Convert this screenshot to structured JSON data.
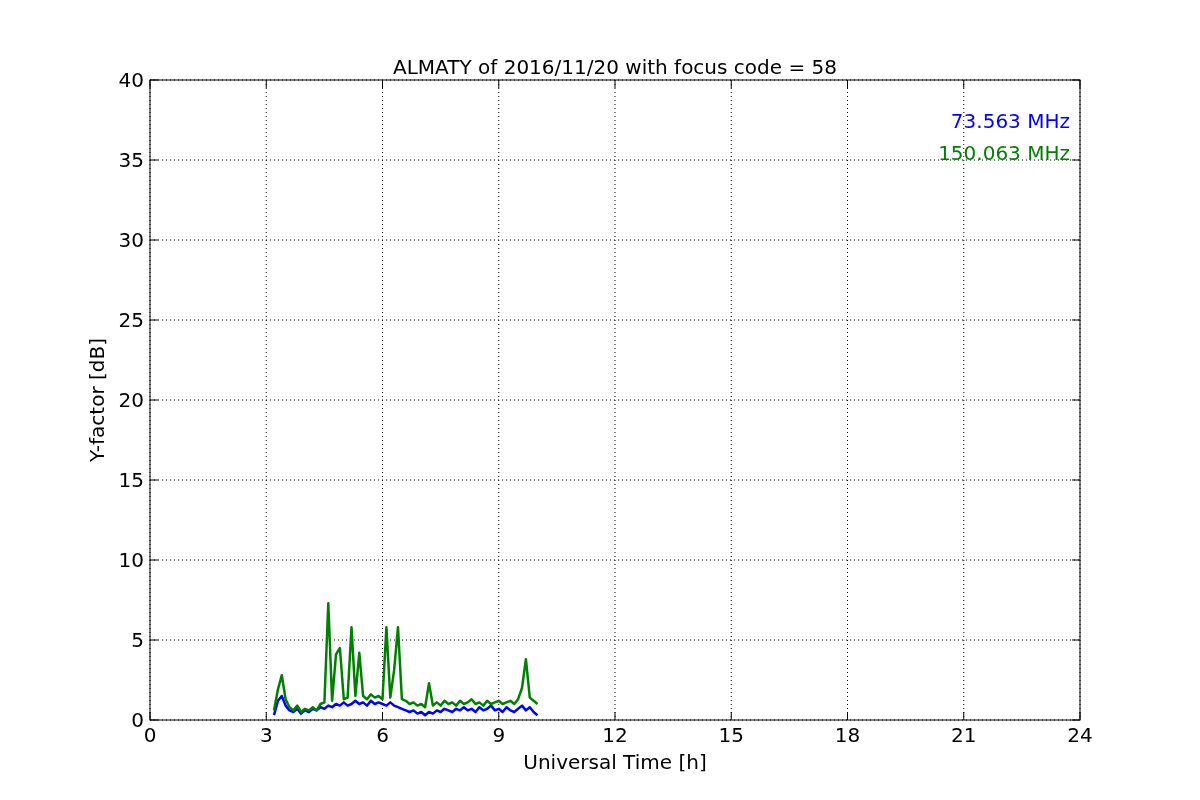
{
  "chart_data": {
    "type": "line",
    "title": "ALMATY of 2016/11/20 with focus code = 58",
    "xlabel": "Universal Time [h]",
    "ylabel": "Y-factor [dB]",
    "x": [
      3.2,
      3.3,
      3.4,
      3.5,
      3.6,
      3.7,
      3.8,
      3.9,
      4.0,
      4.1,
      4.2,
      4.3,
      4.4,
      4.5,
      4.6,
      4.7,
      4.8,
      4.9,
      5.0,
      5.1,
      5.2,
      5.3,
      5.4,
      5.5,
      5.6,
      5.7,
      5.8,
      5.9,
      6.0,
      6.1,
      6.2,
      6.3,
      6.4,
      6.5,
      6.6,
      6.7,
      6.8,
      6.9,
      7.0,
      7.1,
      7.2,
      7.3,
      7.4,
      7.5,
      7.6,
      7.7,
      7.8,
      7.9,
      8.0,
      8.1,
      8.2,
      8.3,
      8.4,
      8.5,
      8.6,
      8.7,
      8.8,
      8.9,
      9.0,
      9.1,
      9.2,
      9.3,
      9.4,
      9.5,
      9.6,
      9.7,
      9.8,
      9.9,
      10.0
    ],
    "series": [
      {
        "name": "73.563 MHz",
        "color": "#0000ff",
        "values": [
          0.3,
          1.2,
          1.5,
          0.9,
          0.6,
          0.5,
          0.7,
          0.4,
          0.6,
          0.5,
          0.7,
          0.6,
          0.8,
          0.7,
          0.9,
          0.8,
          1.0,
          0.9,
          1.1,
          0.9,
          1.0,
          1.2,
          1.0,
          1.1,
          0.9,
          1.2,
          1.0,
          1.1,
          1.0,
          0.9,
          1.1,
          0.9,
          0.8,
          0.7,
          0.6,
          0.5,
          0.6,
          0.4,
          0.5,
          0.3,
          0.5,
          0.4,
          0.6,
          0.5,
          0.7,
          0.6,
          0.5,
          0.7,
          0.6,
          0.8,
          0.6,
          0.7,
          0.5,
          0.8,
          0.6,
          0.7,
          0.9,
          0.6,
          0.7,
          0.5,
          0.8,
          0.6,
          0.5,
          0.7,
          0.9,
          0.6,
          0.8,
          0.5,
          0.3
        ]
      },
      {
        "name": "150.063 MHz",
        "color": "#008000",
        "values": [
          0.6,
          1.9,
          2.8,
          1.3,
          0.8,
          0.6,
          0.9,
          0.5,
          0.7,
          0.6,
          0.8,
          0.6,
          1.0,
          1.1,
          7.3,
          1.2,
          4.1,
          4.5,
          1.3,
          1.4,
          5.8,
          1.5,
          4.2,
          1.5,
          1.3,
          1.6,
          1.4,
          1.5,
          1.3,
          5.8,
          1.4,
          3.1,
          5.8,
          1.3,
          1.2,
          1.0,
          1.1,
          0.9,
          1.0,
          0.8,
          2.3,
          0.9,
          1.1,
          0.9,
          1.2,
          1.0,
          1.1,
          0.9,
          1.2,
          1.0,
          1.1,
          1.3,
          1.0,
          1.1,
          0.9,
          1.2,
          1.0,
          1.1,
          1.2,
          1.0,
          1.1,
          1.2,
          1.0,
          1.3,
          2.0,
          3.8,
          1.4,
          1.2,
          1.0
        ]
      }
    ],
    "xlim": [
      0,
      24
    ],
    "ylim": [
      0,
      40
    ],
    "xticks": [
      0,
      3,
      6,
      9,
      12,
      15,
      18,
      21,
      24
    ],
    "yticks": [
      0,
      5,
      10,
      15,
      20,
      25,
      30,
      35,
      40
    ],
    "grid": true
  }
}
